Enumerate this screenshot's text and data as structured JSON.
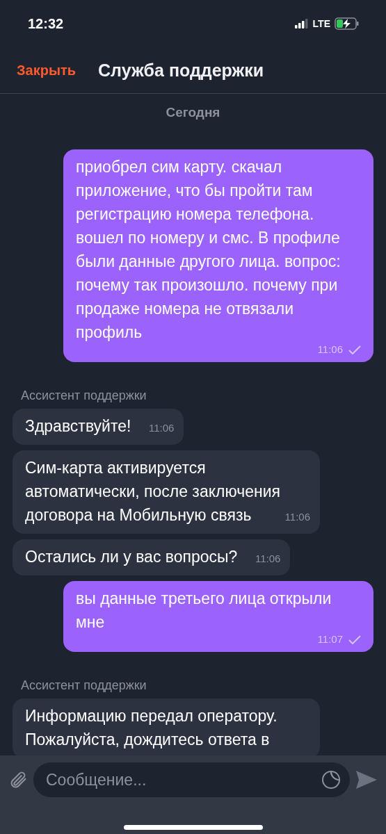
{
  "status_bar": {
    "time": "12:32",
    "network": "LTE"
  },
  "header": {
    "close": "Закрыть",
    "title": "Служба поддержки"
  },
  "messages": [
    {
      "kind": "date",
      "text": "Сегодня"
    },
    {
      "kind": "outgoing",
      "text": "приобрел сим карту. скачал приложение, что бы пройти там регистрацию номера телефона. вошел по номеру и смс. В профиле были данные другого лица. вопрос: почему так произошло. почему при продаже номера не отвязали профиль",
      "time": "11:06",
      "delivered": true
    },
    {
      "kind": "sender",
      "text": "Ассистент поддержки"
    },
    {
      "kind": "incoming",
      "text": "Здравствуйте!",
      "time": "11:06"
    },
    {
      "kind": "incoming",
      "text": "Сим-карта активируется автоматически, после заключения договора на Мобильную связь",
      "time": "11:06"
    },
    {
      "kind": "incoming",
      "text": "Остались ли у вас вопросы?",
      "time": "11:06"
    },
    {
      "kind": "outgoing",
      "text": "вы данные третьего лица открыли мне",
      "time": "11:07",
      "delivered": true
    },
    {
      "kind": "sender",
      "text": "Ассистент поддержки"
    },
    {
      "kind": "incoming",
      "text": "Информацию передал оператору. Пожалуйста, дождитесь ответа в"
    }
  ],
  "composer": {
    "placeholder": "Сообщение..."
  }
}
